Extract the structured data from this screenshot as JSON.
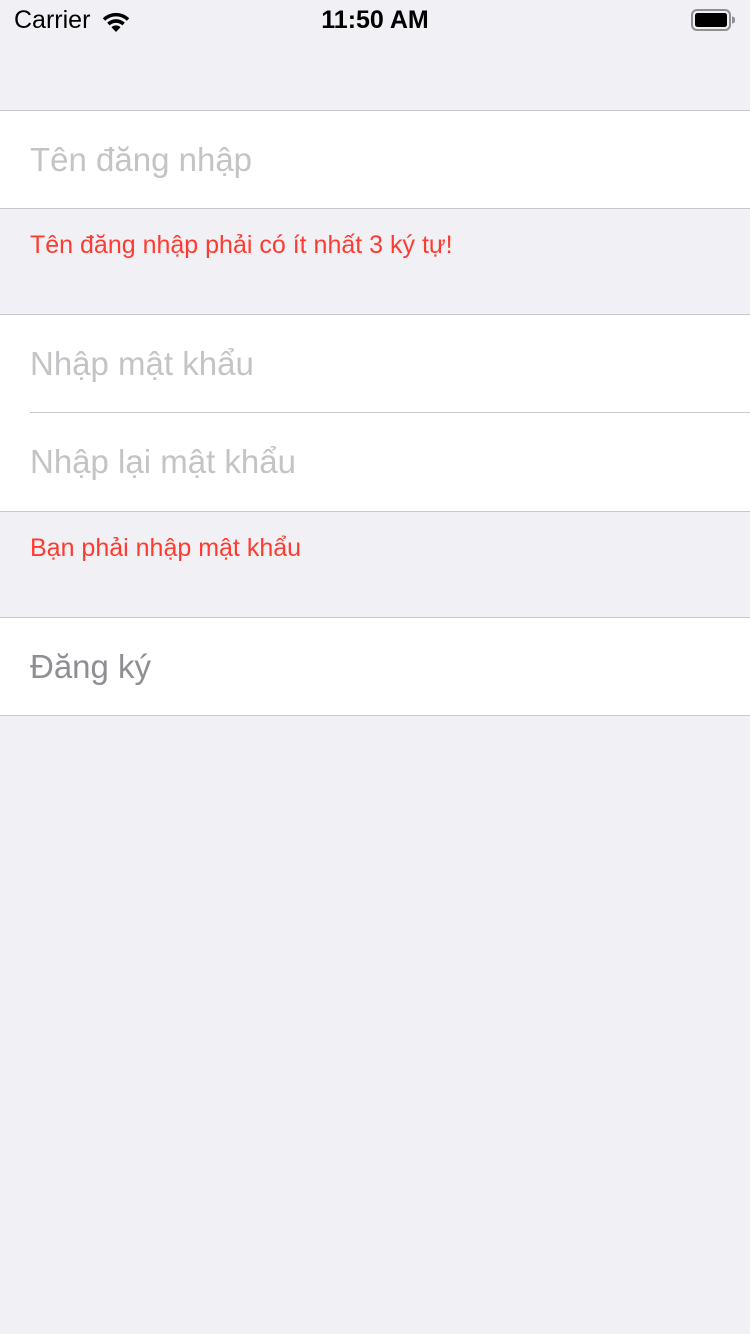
{
  "status_bar": {
    "carrier": "Carrier",
    "time": "11:50 AM",
    "wifi_icon": "wifi-icon",
    "battery_icon": "battery-full-icon"
  },
  "username_section": {
    "username_field": {
      "value": "",
      "placeholder": "Tên đăng nhập"
    },
    "error": "Tên đăng nhập phải có ít nhất 3 ký tự!"
  },
  "password_section": {
    "password_field": {
      "value": "",
      "placeholder": "Nhập mật khẩu"
    },
    "confirm_password_field": {
      "value": "",
      "placeholder": "Nhập lại mật khẩu"
    },
    "error": "Bạn phải nhập mật khẩu"
  },
  "register_button": {
    "label": "Đăng ký"
  },
  "colors": {
    "background": "#f0f0f5",
    "error": "#ff3b30",
    "placeholder": "#c4c4c6",
    "disabled_button": "#8e8e93",
    "separator": "#c8c7cc"
  }
}
